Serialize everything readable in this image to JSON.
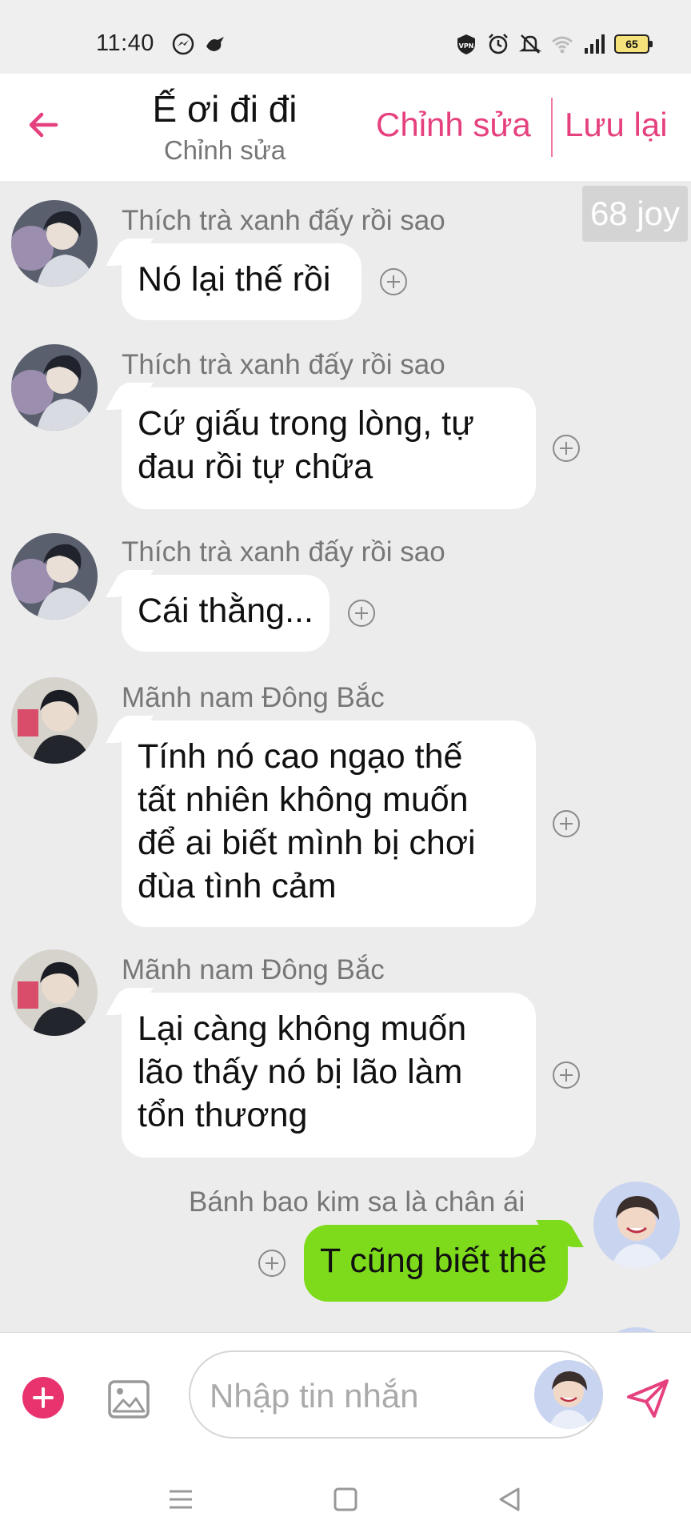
{
  "status_bar": {
    "time": "11:40",
    "battery": "65",
    "left_icons": [
      "messenger-icon",
      "bird-icon"
    ],
    "right_icons": [
      "vpn-icon",
      "alarm-icon",
      "mute-icon",
      "wifi-icon",
      "signal-icon",
      "battery-icon"
    ]
  },
  "header": {
    "title": "Ế ơi đi đi",
    "subtitle": "Chỉnh sửa",
    "edit_label": "Chỉnh sửa",
    "save_label": "Lưu lại",
    "accent_color": "#e6417f"
  },
  "chat": {
    "joy_badge": "68 joy",
    "messages": [
      {
        "sender": "Thích trà xanh đấy rồi sao",
        "text": "Nó lại thế rồi",
        "mine": false
      },
      {
        "sender": "Thích trà xanh đấy rồi sao",
        "text_lines": [
          "Cứ giấu trong lòng, tự",
          "đau rồi tự chữa"
        ],
        "mine": false
      },
      {
        "sender": "Thích trà xanh đấy rồi sao",
        "text": "Cái thằng...",
        "mine": false
      },
      {
        "sender": "Mãnh nam Đông Bắc",
        "text_lines": [
          "Tính nó cao ngạo thế",
          "tất nhiên không muốn",
          "để ai biết mình bị chơi",
          "đùa tình cảm"
        ],
        "mine": false
      },
      {
        "sender": "Mãnh nam Đông Bắc",
        "text_lines": [
          "Lại càng không muốn",
          "lão thấy nó bị lão làm",
          "tổn thương"
        ],
        "mine": false
      },
      {
        "sender": "Bánh bao kim sa là chân ái",
        "text": "T cũng biết thế",
        "mine": true,
        "bubble_color": "#7edb1b"
      }
    ]
  },
  "input_bar": {
    "placeholder": "Nhập tin nhắn",
    "add_color": "#e8336f"
  },
  "nav_bar": {
    "icons": [
      "menu-icon",
      "home-icon",
      "back-icon"
    ]
  }
}
